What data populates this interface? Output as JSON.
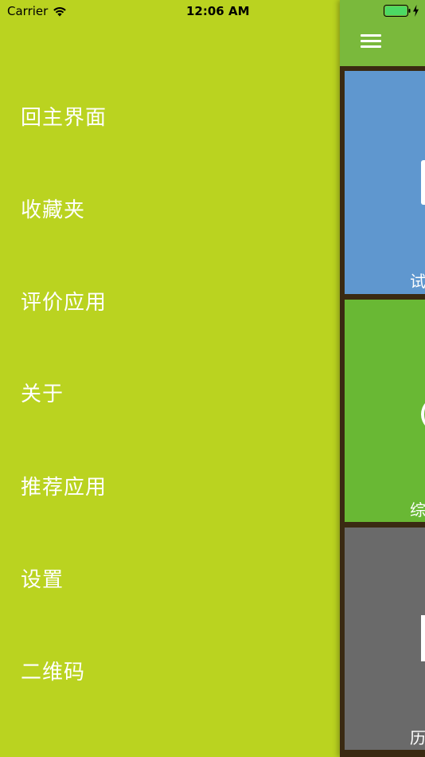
{
  "status_bar": {
    "carrier": "Carrier",
    "time": "12:06 AM",
    "battery_color": "#4cd964"
  },
  "menu": {
    "items": [
      {
        "label": "回主界面"
      },
      {
        "label": "收藏夹"
      },
      {
        "label": "评价应用"
      },
      {
        "label": "关于"
      },
      {
        "label": "推荐应用"
      },
      {
        "label": "设置"
      },
      {
        "label": "二维码"
      }
    ]
  },
  "content": {
    "tiles": [
      {
        "label": "试",
        "color": "#5f97cf"
      },
      {
        "label": "综",
        "color": "#69b834"
      },
      {
        "label": "历",
        "color": "#6a6a6a"
      }
    ]
  },
  "colors": {
    "menu_background": "#bad320",
    "nav_bar": "#7ab93c"
  }
}
